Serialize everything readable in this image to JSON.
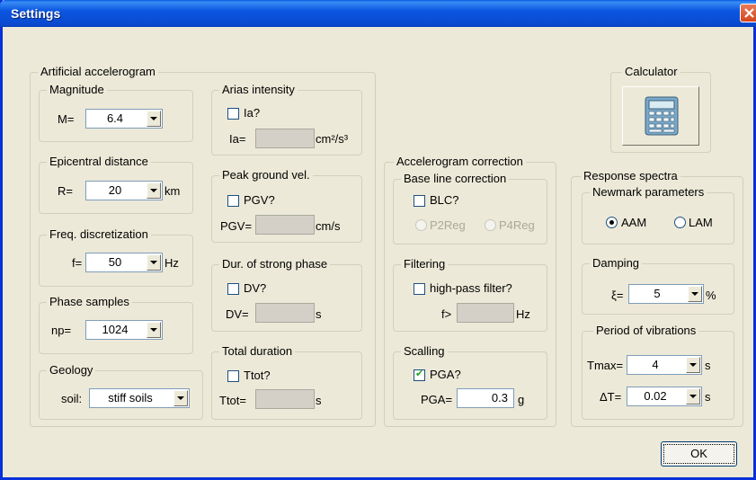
{
  "window": {
    "title": "Settings"
  },
  "artificial": {
    "legend": "Artificial accelerogram",
    "magnitude": {
      "legend": "Magnitude",
      "label": "M=",
      "value": "6.4"
    },
    "epicentral": {
      "legend": "Epicentral distance",
      "label": "R=",
      "value": "20",
      "unit": "km"
    },
    "freq": {
      "legend": "Freq. discretization",
      "label": "f=",
      "value": "50",
      "unit": "Hz"
    },
    "phase": {
      "legend": "Phase samples",
      "label": "np=",
      "value": "1024"
    },
    "geology": {
      "legend": "Geology",
      "label": "soil:",
      "value": "stiff soils"
    },
    "arias": {
      "legend": "Arias intensity",
      "check_label": "Ia?",
      "checked": false,
      "label": "Ia=",
      "value": "",
      "unit": "cm²/s³"
    },
    "pgv": {
      "legend": "Peak ground vel.",
      "check_label": "PGV?",
      "checked": false,
      "label": "PGV=",
      "value": "",
      "unit": "cm/s"
    },
    "dur_strong": {
      "legend": "Dur. of strong phase",
      "check_label": "DV?",
      "checked": false,
      "label": "DV=",
      "value": "",
      "unit": "s"
    },
    "total": {
      "legend": "Total duration",
      "check_label": "Ttot?",
      "checked": false,
      "label": "Ttot=",
      "value": "",
      "unit": "s"
    }
  },
  "calculator": {
    "legend": "Calculator",
    "icon": "calculator-icon"
  },
  "correction": {
    "legend": "Accelerogram correction",
    "baseline": {
      "legend": "Base line correction",
      "check_label": "BLC?",
      "checked": false,
      "radio1": "P2Reg",
      "radio2": "P4Reg"
    },
    "filtering": {
      "legend": "Filtering",
      "check_label": "high-pass filter?",
      "checked": false,
      "label": "f>",
      "value": "",
      "unit": "Hz"
    },
    "scalling": {
      "legend": "Scalling",
      "check_label": "PGA?",
      "checked": true,
      "label": "PGA=",
      "value": "0.3",
      "unit": "g"
    }
  },
  "response": {
    "legend": "Response spectra",
    "newmark": {
      "legend": "Newmark parameters",
      "opt1": "AAM",
      "opt2": "LAM",
      "selected": "AAM"
    },
    "damping": {
      "legend": "Damping",
      "label": "ξ=",
      "value": "5",
      "unit": "%"
    },
    "period": {
      "legend": "Period of vibrations",
      "tmax_label": "Tmax=",
      "tmax_value": "4",
      "tmax_unit": "s",
      "dt_label": "ΔT=",
      "dt_value": "0.02",
      "dt_unit": "s"
    }
  },
  "ok_button": "OK"
}
